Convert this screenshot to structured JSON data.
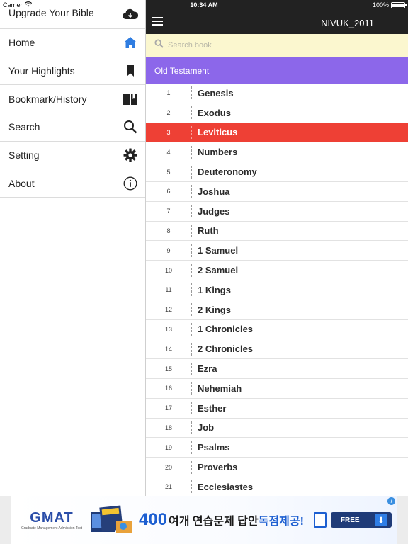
{
  "status_bar": {
    "carrier": "Carrier",
    "time": "10:34 AM",
    "battery": "100%"
  },
  "sidebar": {
    "items": [
      {
        "label": "Upgrade Your Bible",
        "icon": "cloud-download-icon"
      },
      {
        "label": "Home",
        "icon": "home-icon"
      },
      {
        "label": "Your Highlights",
        "icon": "bookmark-icon"
      },
      {
        "label": "Bookmark/History",
        "icon": "book-icon"
      },
      {
        "label": "Search",
        "icon": "search-icon"
      },
      {
        "label": "Setting",
        "icon": "gear-icon"
      },
      {
        "label": "About",
        "icon": "info-icon"
      }
    ],
    "active_icon_color": "#2f7de1"
  },
  "header": {
    "title": "NIVUK_2011"
  },
  "search": {
    "placeholder": "Search book"
  },
  "section": {
    "title": "Old Testament",
    "color": "#8c67ea"
  },
  "books": [
    {
      "num": "1",
      "name": "Genesis"
    },
    {
      "num": "2",
      "name": "Exodus"
    },
    {
      "num": "3",
      "name": "Leviticus"
    },
    {
      "num": "4",
      "name": "Numbers"
    },
    {
      "num": "5",
      "name": "Deuteronomy"
    },
    {
      "num": "6",
      "name": "Joshua"
    },
    {
      "num": "7",
      "name": "Judges"
    },
    {
      "num": "8",
      "name": "Ruth"
    },
    {
      "num": "9",
      "name": "1 Samuel"
    },
    {
      "num": "10",
      "name": "2 Samuel"
    },
    {
      "num": "11",
      "name": "1 Kings"
    },
    {
      "num": "12",
      "name": "2 Kings"
    },
    {
      "num": "13",
      "name": "1 Chronicles"
    },
    {
      "num": "14",
      "name": "2 Chronicles"
    },
    {
      "num": "15",
      "name": "Ezra"
    },
    {
      "num": "16",
      "name": "Nehemiah"
    },
    {
      "num": "17",
      "name": "Esther"
    },
    {
      "num": "18",
      "name": "Job"
    },
    {
      "num": "19",
      "name": "Psalms"
    },
    {
      "num": "20",
      "name": "Proverbs"
    },
    {
      "num": "21",
      "name": "Ecclesiastes"
    }
  ],
  "selected_book": "Leviticus",
  "selected_color": "#ee4035",
  "ad": {
    "logo": "GMAT",
    "logo_sub": "Graduate Management Admission Test",
    "number": "400",
    "text1": "여개 연습문제 답안",
    "text2": "독점제공!",
    "button": "FREE"
  }
}
